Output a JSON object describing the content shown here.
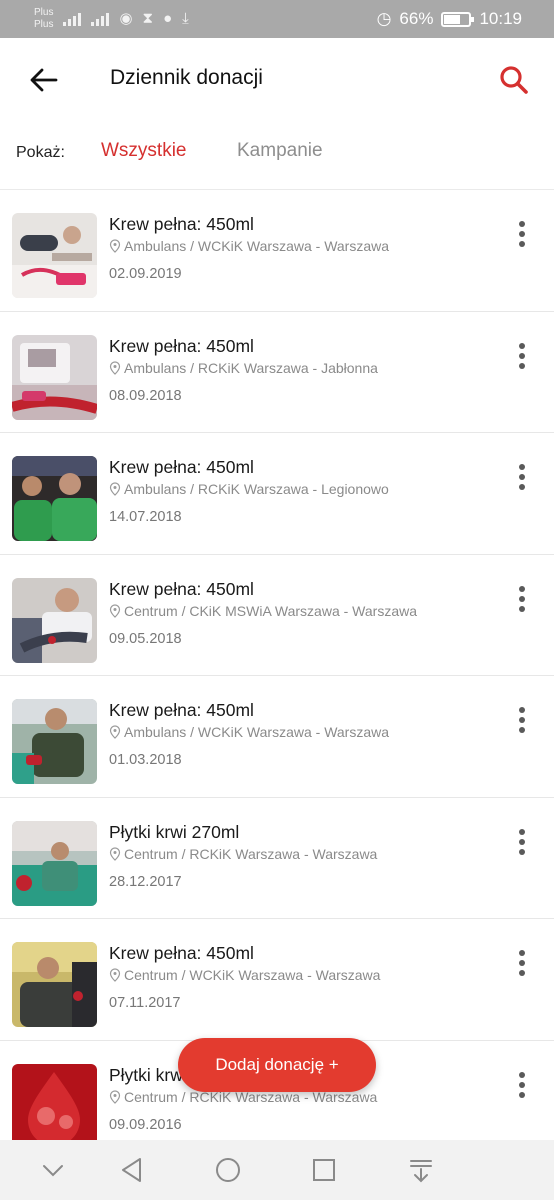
{
  "status_bar": {
    "carrier1": "Plus",
    "carrier2": "Plus",
    "battery": "66%",
    "battery_level": 0.66,
    "time": "10:19"
  },
  "header": {
    "title": "Dziennik donacji",
    "back_icon": "arrow-left-icon",
    "search_icon": "search-icon"
  },
  "filter": {
    "label": "Pokaż:",
    "tabs": [
      "Wszystkie",
      "Kampanie"
    ],
    "active": "Wszystkie"
  },
  "donations": [
    {
      "title": "Krew pełna: 450ml",
      "location": "Ambulans / WCKiK Warszawa - Warszawa",
      "date": "02.09.2019"
    },
    {
      "title": "Krew pełna: 450ml",
      "location": "Ambulans / RCKiK Warszawa - Jabłonna",
      "date": "08.09.2018"
    },
    {
      "title": "Krew pełna: 450ml",
      "location": "Ambulans / RCKiK Warszawa - Legionowo",
      "date": "14.07.2018"
    },
    {
      "title": "Krew pełna: 450ml",
      "location": "Centrum / CKiK MSWiA Warszawa - Warszawa",
      "date": "09.05.2018"
    },
    {
      "title": "Krew pełna: 450ml",
      "location": "Ambulans / WCKiK Warszawa - Warszawa",
      "date": "01.03.2018"
    },
    {
      "title": "Płytki krwi 270ml",
      "location": "Centrum / RCKiK Warszawa - Warszawa",
      "date": "28.12.2017"
    },
    {
      "title": "Krew pełna: 450ml",
      "location": "Centrum / WCKiK Warszawa - Warszawa",
      "date": "07.11.2017"
    },
    {
      "title": "Płytki krwi 270ml",
      "location": "Centrum / RCKiK Warszawa - Warszawa",
      "date": "09.09.2016"
    }
  ],
  "fab": {
    "label": "Dodaj donację +"
  },
  "colors": {
    "accent": "#d5302f",
    "fab": "#e33b2f",
    "muted": "#8e8e8e"
  },
  "nav": {
    "icons": [
      "chevron-down-icon",
      "back-triangle-icon",
      "home-circle-icon",
      "recents-square-icon",
      "notification-pull-icon"
    ]
  }
}
